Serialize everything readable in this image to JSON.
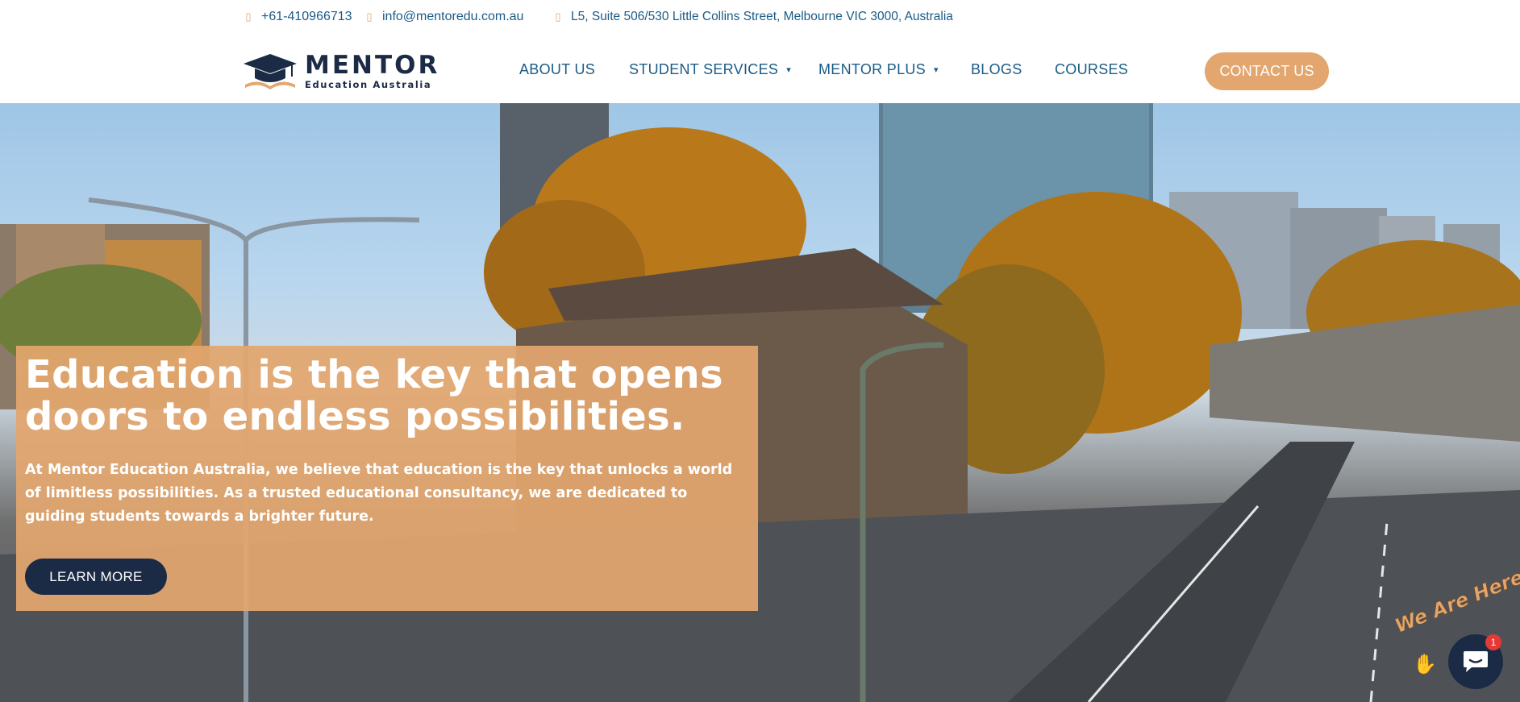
{
  "topbar": {
    "phone": "+61-410966713",
    "email": "info@mentoredu.com.au",
    "address": "L5, Suite 506/530 Little Collins Street, Melbourne VIC 3000, Australia",
    "phone_icon": "phone-icon",
    "email_icon": "mail-icon",
    "address_icon": "map-marker-icon"
  },
  "logo": {
    "name": "MENTOR",
    "tagline": "Education Australia"
  },
  "nav": {
    "items": [
      {
        "label": "ABOUT US"
      },
      {
        "label": "STUDENT SERVICES",
        "caret": "▾"
      },
      {
        "label": "MENTOR PLUS",
        "caret": "▾"
      },
      {
        "label": "BLOGS"
      },
      {
        "label": "COURSES"
      }
    ],
    "contact_label": "CONTACT US"
  },
  "hero": {
    "title": "Education is the key that opens doors to endless possibilities.",
    "text": "At Mentor Education Australia, we believe that education is the key that unlocks a world of limitless possibilities. As a trusted educational consultancy, we are dedicated to guiding students towards a brighter future.",
    "button_label": "LEARN MORE"
  },
  "chat": {
    "tag": "We Are Here!",
    "badge_count": "1"
  },
  "colors": {
    "accent": "#e2a66e",
    "navy": "#1c2b45",
    "link": "#1b5b86"
  }
}
